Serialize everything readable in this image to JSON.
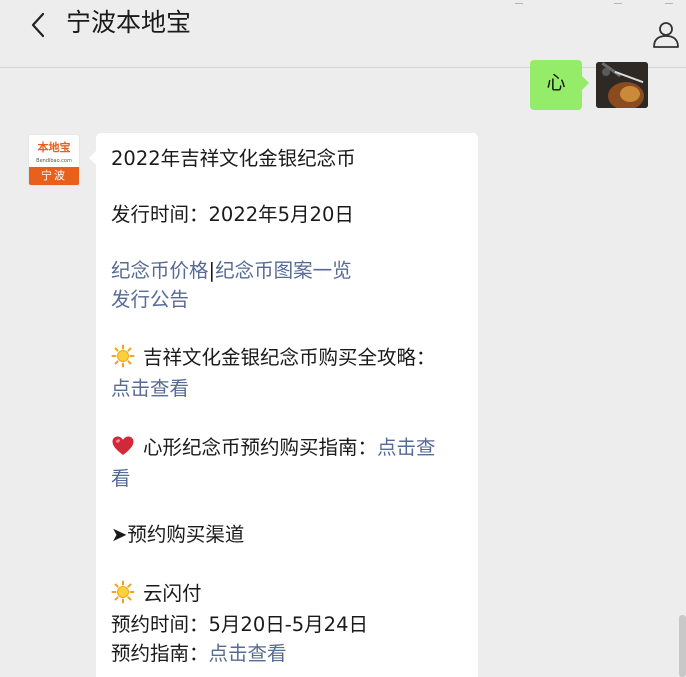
{
  "header": {
    "title": "宁波本地宝"
  },
  "outgoing_message": {
    "text": "心"
  },
  "bot_avatar": {
    "logo_text": "本地宝",
    "logo_url": "Bendibao.com",
    "city": "宁波"
  },
  "incoming_message": {
    "title": "2022年吉祥文化金银纪念币",
    "release_time": "发行时间：2022年5月20日",
    "link_price": "纪念币价格",
    "separator": "|",
    "link_patterns": "纪念币图案一览",
    "link_notice": "发行公告",
    "guide_label": "吉祥文化金银纪念币购买全攻略：",
    "guide_link": "点击查看",
    "heart_label": "心形纪念币预约购买指南：",
    "heart_link_a": "点击查",
    "heart_link_b": "看",
    "channel_heading": "➤预约购买渠道",
    "yunshanfu_label": "云闪付",
    "reserve_time": "预约时间：5月20日-5月24日",
    "reserve_guide_label": "预约指南：",
    "reserve_guide_link": "点击查看"
  },
  "icons": {
    "back": "chevron-left-icon",
    "profile": "person-icon",
    "sun": "sun-emoji",
    "heart": "heart-emoji"
  },
  "colors": {
    "background": "#ededed",
    "outgoing_bubble": "#95ec69",
    "incoming_bubble": "#ffffff",
    "link": "#576b95",
    "brand_orange": "#e8601c"
  }
}
